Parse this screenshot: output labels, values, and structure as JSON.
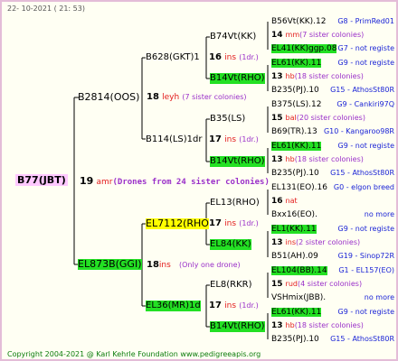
{
  "header": {
    "date": "22- 10-2021 ( 21: 53)"
  },
  "footer": {
    "copyright": "Copyright 2004-2021 @ Karl Kehrle Foundation    www.pedigreeapis.org"
  },
  "root": {
    "id": "B77(JBT)",
    "num": "19",
    "race": "amr",
    "note": "(Drones from 24 sister colonies)"
  },
  "gen1": [
    {
      "id": "B2814(OOS)",
      "num": "18",
      "race": "leyh",
      "note": "(7 sister colonies)"
    },
    {
      "id": "EL873B(GGI)",
      "num": "18",
      "race": "ins",
      "note": "(Only one drone)"
    }
  ],
  "gen2": [
    {
      "id": "B628(GKT)1",
      "num": "16",
      "race": "ins",
      "note": "(1dr.)"
    },
    {
      "id": "B114(LS)1dr",
      "num": "17",
      "race": "ins",
      "note": "(1dr.)"
    },
    {
      "id": "EL7112(RHO",
      "num": "17",
      "race": "ins",
      "note": "(1dr.)"
    },
    {
      "id": "EL36(MR)1d",
      "num": "17",
      "race": "ins",
      "note": "(1dr.)"
    }
  ],
  "gen3": [
    "B74Vt(KK)",
    "B14Vt(RHO)",
    "B35(LS)",
    "B14Vt(RHO)",
    "EL13(RHO)",
    "EL84(KK)",
    "EL8(RKR)",
    "B14Vt(RHO)"
  ],
  "gen4": [
    {
      "id": "B56Vt(KK).12",
      "right": "G8 - PrimRed01"
    },
    {
      "num": "14",
      "race": "mm",
      "note": "(7 sister colonies)"
    },
    {
      "id": "EL41(KK)ggp.08",
      "right": "G7 - not registe"
    },
    {
      "id": "EL61(KK).11",
      "right": "G9 - not registe"
    },
    {
      "num": "13",
      "race": "hb",
      "note": "(18 sister colonies)"
    },
    {
      "id": "B235(PJ).10",
      "right": "G15 - AthosSt80R"
    },
    {
      "id": "B375(LS).12",
      "right": "G9 - Cankiri97Q"
    },
    {
      "num": "15",
      "race": "bal",
      "note": "(20 sister colonies)"
    },
    {
      "id": "B69(TR).13",
      "right": "G10 - Kangaroo98R"
    },
    {
      "id": "EL61(KK).11",
      "right": "G9 - not registe"
    },
    {
      "num": "13",
      "race": "hb",
      "note": "(18 sister colonies)"
    },
    {
      "id": "B235(PJ).10",
      "right": "G15 - AthosSt80R"
    },
    {
      "id": "EL131(EO).16",
      "right": "G0 - elgon breed"
    },
    {
      "num": "16",
      "race": "nat",
      "note": ""
    },
    {
      "id": "Bxx16(EO).",
      "right": "no more"
    },
    {
      "id": "EL1(KK).11",
      "right": "G9 - not registe"
    },
    {
      "num": "13",
      "race": "ins",
      "note": "(2 sister colonies)"
    },
    {
      "id": "B51(AH).09",
      "right": "G19 - Sinop72R"
    },
    {
      "id": "EL104(BB).14",
      "right": "G1 - EL157(EO)"
    },
    {
      "num": "15",
      "race": "rud",
      "note": "(4 sister colonies)"
    },
    {
      "id": "VSHmix(JBB).",
      "right": "no more"
    },
    {
      "id": "EL61(KK).11",
      "right": "G9 - not registe"
    },
    {
      "num": "13",
      "race": "hb",
      "note": "(18 sister colonies)"
    },
    {
      "id": "B235(PJ).10",
      "right": "G15 - AthosSt80R"
    }
  ]
}
